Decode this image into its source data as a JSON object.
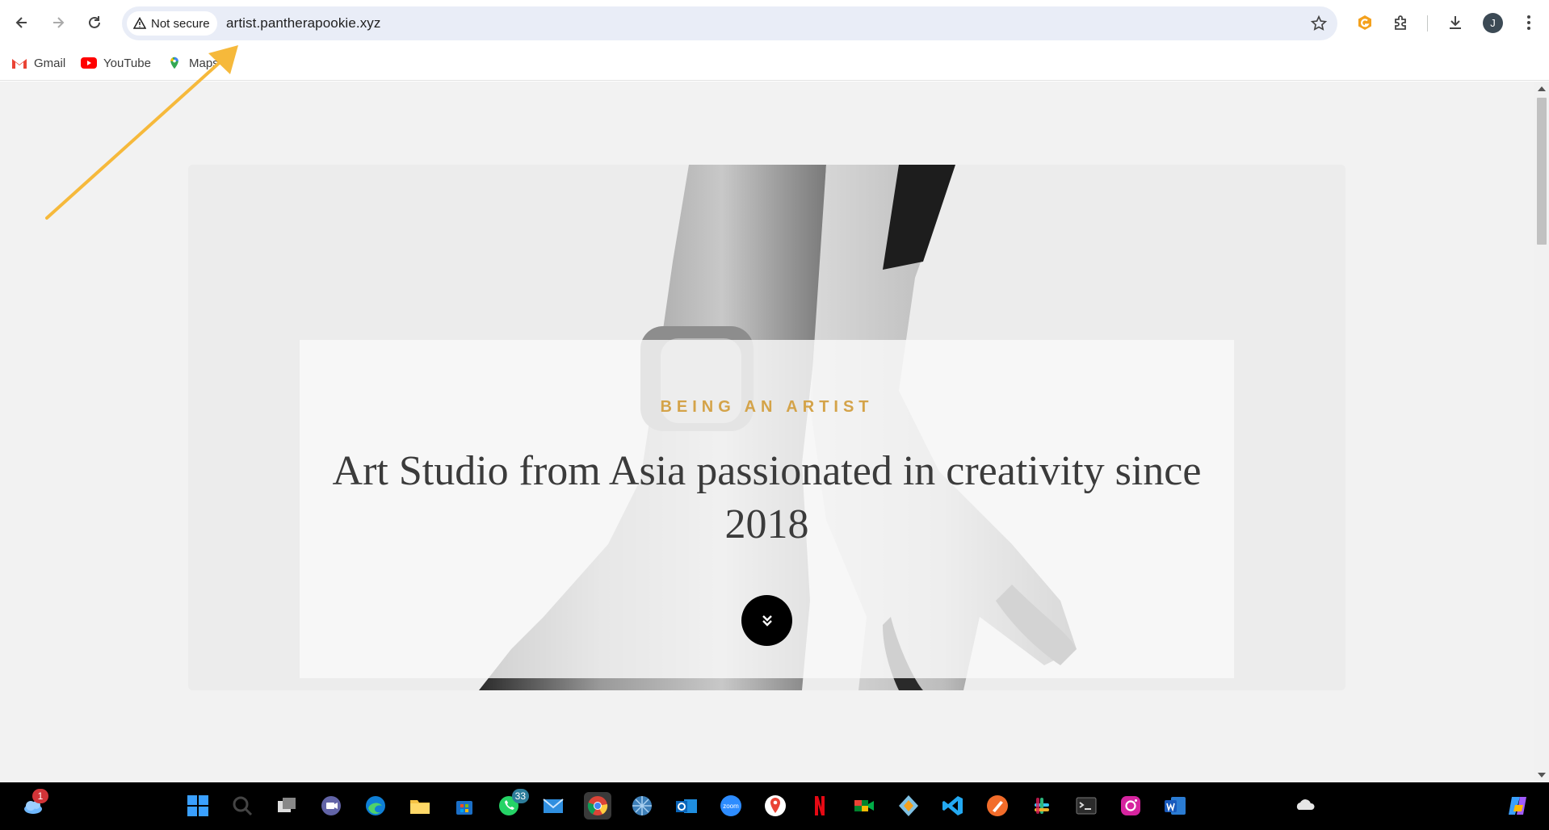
{
  "browser": {
    "security_label": "Not secure",
    "url": "artist.pantherapookie.xyz",
    "profile_initial": "J"
  },
  "bookmarks": [
    {
      "label": "Gmail",
      "icon": "gmail-icon"
    },
    {
      "label": "YouTube",
      "icon": "youtube-icon"
    },
    {
      "label": "Maps",
      "icon": "maps-icon"
    }
  ],
  "hero": {
    "eyebrow": "BEING AN ARTIST",
    "headline": "Art Studio from Asia passionated in creativity since 2018"
  },
  "taskbar": {
    "weather_badge": "1",
    "whatsapp_badge": "33",
    "zoom_label": "zoom"
  },
  "colors": {
    "accent_gold": "#d4a349",
    "annotation_arrow": "#f6b93b",
    "page_bg": "#f2f2f2"
  }
}
